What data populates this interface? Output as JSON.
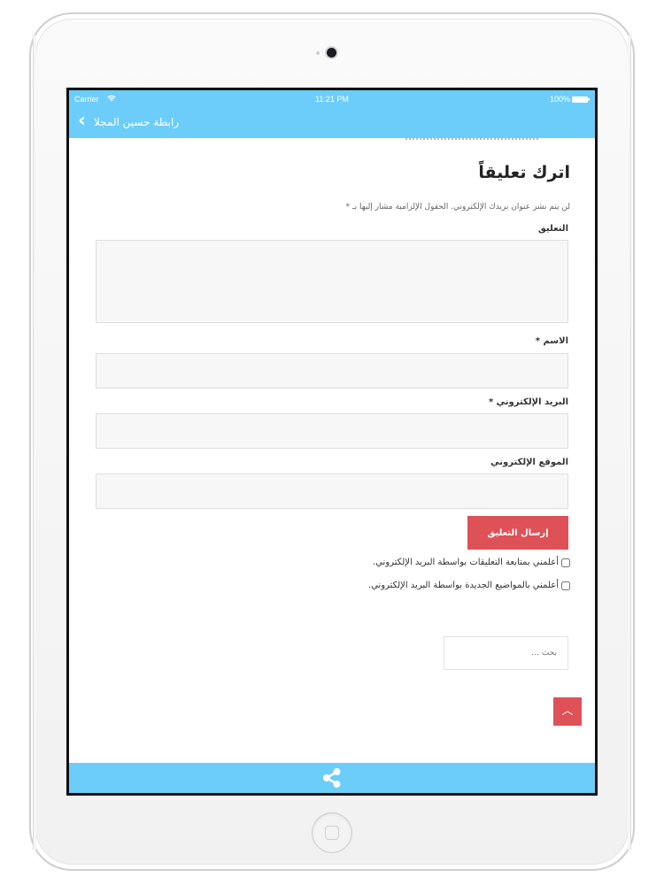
{
  "status_bar": {
    "carrier": "Carrier",
    "time": "11:21 PM",
    "battery": "100%",
    "wifi_icon": "wifi-icon",
    "battery_icon": "battery-icon"
  },
  "nav": {
    "back_label": "رابطة حسين المجلا",
    "back_icon": "chevron-left-icon"
  },
  "form": {
    "title": "اترك تعليقاً",
    "notice": "لن يتم نشر عنوان بريدك الإلكتروني. الحقول الإلزامية مشار إليها بـ *",
    "comment_label": "التعليق",
    "comment_value": "",
    "name_label": "الاسم *",
    "name_value": "",
    "email_label": "البريد الإلكتروني *",
    "email_value": "",
    "website_label": "الموقع الإلكتروني",
    "website_value": "",
    "submit_label": "إرسال التعليق",
    "notify_comments_label": "أعلمني بمتابعة التعليقات بواسطة البريد الإلكتروني.",
    "notify_posts_label": "أعلمني بالمواضيع الجديدة بواسطة البريد الإلكتروني."
  },
  "search": {
    "placeholder": "بحث …"
  },
  "scroll_top": {
    "icon": "chevron-up-icon",
    "glyph": "︿"
  },
  "bottom_bar": {
    "icon": "share-icon"
  },
  "colors": {
    "accent_blue": "#6ccdfa",
    "accent_red": "#de5157",
    "input_bg": "#f7f7f7"
  }
}
